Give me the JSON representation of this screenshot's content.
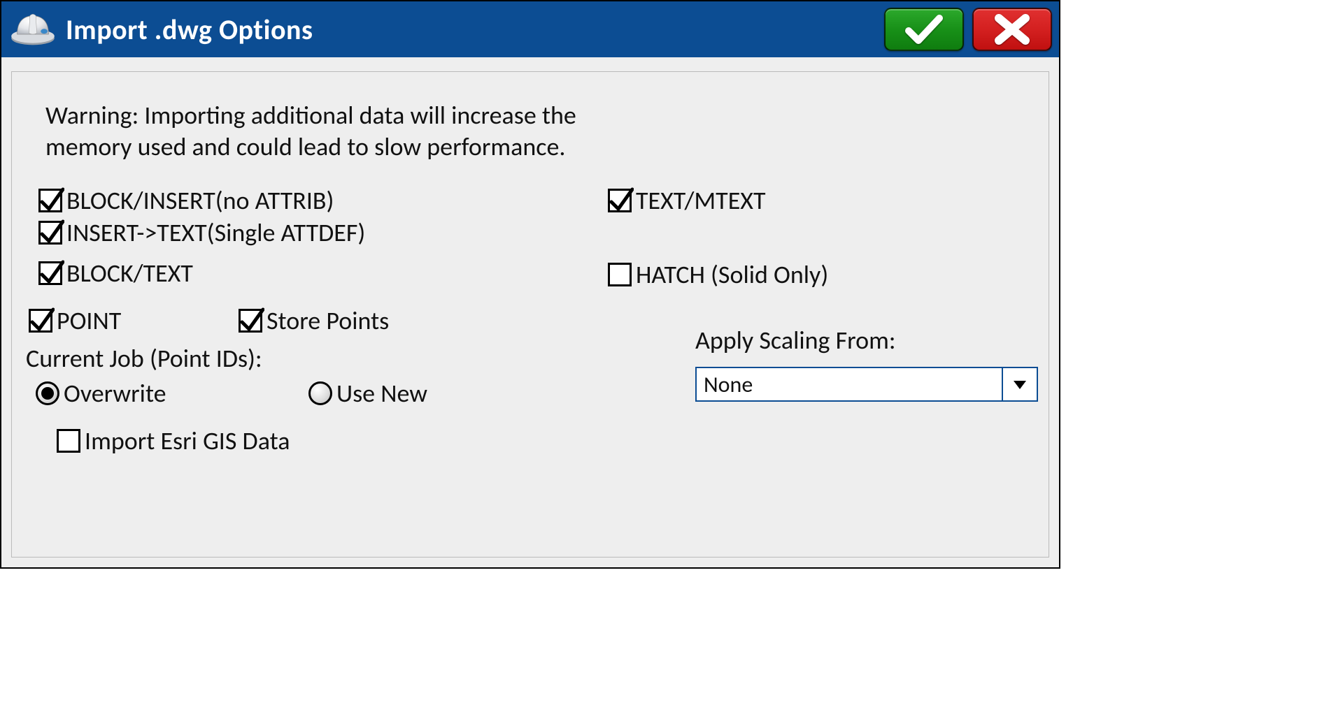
{
  "titlebar": {
    "title": "Import .dwg Options"
  },
  "warning_text": "Warning: Importing additional data will increase the memory used and could lead to slow performance.",
  "checkboxes": {
    "block_insert_no_attrib": {
      "label": "BLOCK/INSERT(no ATTRIB)",
      "checked": true
    },
    "insert_text_single_attdef": {
      "label": "INSERT->TEXT(Single ATTDEF)",
      "checked": true
    },
    "block_text": {
      "label": "BLOCK/TEXT",
      "checked": true
    },
    "text_mtext": {
      "label": "TEXT/MTEXT",
      "checked": true
    },
    "hatch_solid_only": {
      "label": "HATCH (Solid Only)",
      "checked": false
    },
    "point": {
      "label": "POINT",
      "checked": true
    },
    "store_points": {
      "label": "Store Points",
      "checked": true
    },
    "import_esri_gis": {
      "label": "Import Esri GIS Data",
      "checked": false
    }
  },
  "current_job_label": "Current Job (Point IDs):",
  "radios": {
    "overwrite": {
      "label": "Overwrite",
      "selected": true
    },
    "use_new": {
      "label": "Use New",
      "selected": false
    }
  },
  "scaling": {
    "label": "Apply Scaling From:",
    "selected": "None"
  }
}
